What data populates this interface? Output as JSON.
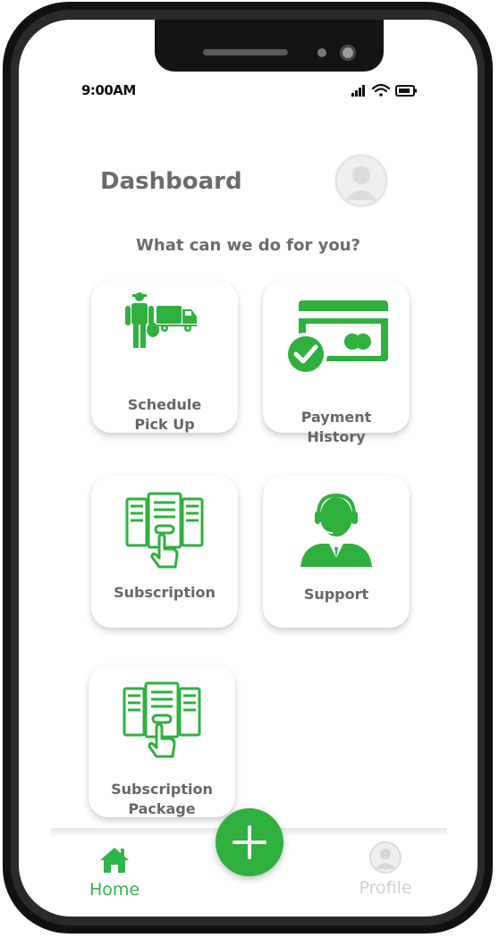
{
  "status_bar": {
    "time": "9:00AM"
  },
  "header": {
    "title": "Dashboard"
  },
  "prompt": "What can we do for you?",
  "cards": [
    {
      "line1": "Schedule",
      "line2": "Pick Up"
    },
    {
      "line1": "Payment",
      "line2": "History"
    },
    {
      "line1": "Subscription",
      "line2": ""
    },
    {
      "line1": "Support",
      "line2": ""
    },
    {
      "line1": "Subscription",
      "line2": "Package"
    }
  ],
  "nav": {
    "home_label": "Home",
    "profile_label": "Profile"
  },
  "colors": {
    "accent": "#2fb03f",
    "text_gray": "#6b6b6b",
    "inactive": "#d2d2d2"
  },
  "icons": [
    "delivery-truck-icon",
    "credit-card-check-icon",
    "subscription-tap-icon",
    "support-agent-icon",
    "home-icon",
    "user-avatar-icon",
    "plus-icon",
    "signal-icon",
    "wifi-icon",
    "battery-icon"
  ]
}
